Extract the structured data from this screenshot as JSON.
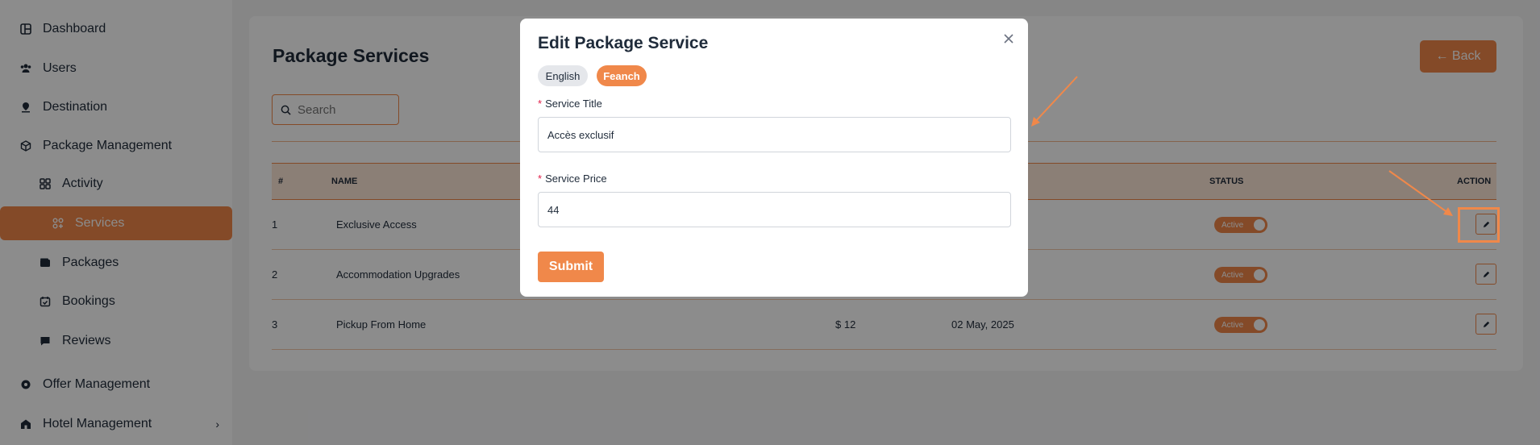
{
  "sidebar": {
    "items": [
      {
        "label": "Dashboard",
        "icon": "dashboard-icon"
      },
      {
        "label": "Users",
        "icon": "users-icon"
      },
      {
        "label": "Destination",
        "icon": "location-pin-icon"
      },
      {
        "label": "Package Management",
        "icon": "cube-icon"
      },
      {
        "label": "Activity",
        "icon": "grid-icon"
      },
      {
        "label": "Services",
        "icon": "services-icon"
      },
      {
        "label": "Packages",
        "icon": "wallet-icon"
      },
      {
        "label": "Bookings",
        "icon": "calendar-check-icon"
      },
      {
        "label": "Reviews",
        "icon": "comment-icon"
      },
      {
        "label": "Offer Management",
        "icon": "badge-icon"
      },
      {
        "label": "Hotel Management",
        "icon": "hotel-icon"
      }
    ],
    "active": "Services",
    "chevron": "›"
  },
  "page": {
    "title": "Package Services",
    "back_label": "← Back",
    "search_placeholder": "Search"
  },
  "table": {
    "headers": {
      "num": "#",
      "name": "NAME",
      "status": "STATUS",
      "action": "ACTION"
    },
    "rows": [
      {
        "num": "1",
        "name": "Exclusive Access",
        "price": "",
        "date": "",
        "status": "Active"
      },
      {
        "num": "2",
        "name": "Accommodation Upgrades",
        "price": "",
        "date": "",
        "status": "Active"
      },
      {
        "num": "3",
        "name": "Pickup From Home",
        "price": "$ 12",
        "date": "02 May, 2025",
        "status": "Active"
      }
    ]
  },
  "modal": {
    "title": "Edit Package Service",
    "lang_en": "English",
    "lang_fr": "Feanch",
    "title_label": "Service Title",
    "title_value": "Accès exclusif",
    "price_label": "Service Price",
    "price_value": "44",
    "required_mark": "*",
    "submit_label": "Submit"
  },
  "colors": {
    "accent": "#f0884a",
    "text": "#1f2b3a"
  }
}
